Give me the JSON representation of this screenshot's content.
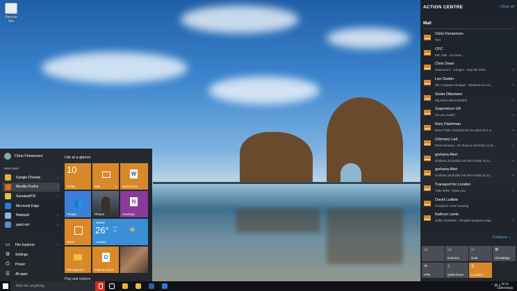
{
  "desktop": {
    "icon_label": "Recycle Bin"
  },
  "start_menu": {
    "user": "Chris Finnamore",
    "most_used_label": "Most used",
    "apps": [
      {
        "label": "Google Chrome",
        "color": "#e8b23a",
        "arrow": true
      },
      {
        "label": "Mozilla Firefox",
        "color": "#e0662a",
        "arrow": true
      },
      {
        "label": "SumatraPDF",
        "color": "#e8c23a",
        "arrow": true
      },
      {
        "label": "Microsoft Edge",
        "color": "#2a7bd9",
        "arrow": false
      },
      {
        "label": "Notepad",
        "color": "#8fb8d8",
        "arrow": true
      },
      {
        "label": "paint.net",
        "color": "#5a8ad0",
        "arrow": true
      }
    ],
    "system": [
      {
        "label": "File Explorer",
        "icon": "folder-icon",
        "glyph": "▭",
        "arrow": true
      },
      {
        "label": "Settings",
        "icon": "gear-icon",
        "glyph": "⚙",
        "arrow": false
      },
      {
        "label": "Power",
        "icon": "power-icon",
        "glyph": "⏻",
        "arrow": false
      },
      {
        "label": "All apps",
        "icon": "list-icon",
        "glyph": "☰",
        "arrow": false
      }
    ],
    "life_heading": "Life at a glance",
    "play_heading": "Play and explore",
    "tiles": {
      "calendar_day": "10",
      "calendar_label": "Friday",
      "mail_label": "Mail",
      "mail_count": "1",
      "word_label": "Word 2013",
      "people_label": "People",
      "photos_label": "Photos",
      "onenote_label": "OneNote",
      "store_label": "Store",
      "weather_condition": "Sunny",
      "weather_temp": "26°",
      "weather_hilo": "27°\n17°",
      "weather_city": "London",
      "fileexplorer_label": "File Explorer",
      "outlook_label": "Outlook 2013",
      "news_label": ""
    }
  },
  "taskbar": {
    "search_placeholder": "Ask me anything",
    "time": "11:11",
    "date": "10/07/2015",
    "apps": [
      {
        "name": "task-view-icon",
        "color": "#ffffff"
      },
      {
        "name": "chrome-icon",
        "color": "#e8b23a"
      },
      {
        "name": "file-explorer-icon",
        "color": "#e8c23a"
      },
      {
        "name": "word-icon",
        "color": "#2a5fb0"
      },
      {
        "name": "outlook-icon",
        "color": "#2a7bd9"
      }
    ]
  },
  "action_centre": {
    "title": "ACTION CENTRE",
    "clear_all": "Clear all",
    "mail_header": "Mail",
    "notifications": [
      {
        "from": "Chris Finnamore",
        "msg": "Test",
        "chevron": false
      },
      {
        "from": "CPC",
        "msg": "BIG Sale - Out Now...",
        "chevron": false
      },
      {
        "from": "Chris Dean",
        "msg": "Gamescom - Cologne - Sept 5th 2015",
        "chevron": true
      },
      {
        "from": "Lee Geden",
        "msg": "RE: Computer Shopper - Windows 10 em...",
        "chevron": true
      },
      {
        "from": "Giulia Ottaviano",
        "msg": "Big News about NUMIX!",
        "chevron": true
      },
      {
        "from": "Supermicro UK",
        "msg": "Are you ready?",
        "chevron": true
      },
      {
        "from": "Rory Flashman",
        "msg": "News Flash: Exceptional Innovation B.V. a...",
        "chevron": true
      },
      {
        "from": "Chimney Lad",
        "msg": "Press Release - EH Turns to MARVEL CUS...",
        "chevron": true
      },
      {
        "from": "gorkana Alert",
        "msg": "Gorkana Journalist Job Alert Friday 10 Ju...",
        "chevron": true
      },
      {
        "from": "gorkana Alert",
        "msg": "Gorkana Journalist Job Alert Friday 10 Ju...",
        "chevron": true
      },
      {
        "from": "Transport for London",
        "msg": "Tube strike - thank you",
        "chevron": true
      },
      {
        "from": "David Ludlow",
        "msg": "Accepted: Cover meeting",
        "chevron": false
      },
      {
        "from": "Kathryn Lamb",
        "msg": "Scifier R100000 - Versatile speakers requi...",
        "chevron": true
      }
    ],
    "collapse": "Collapse",
    "quick_actions": [
      {
        "label": "",
        "glyph": "▭",
        "icon": "tablet-mode-icon",
        "active": false
      },
      {
        "label": "Connect",
        "glyph": "▭",
        "icon": "connect-icon",
        "active": false
      },
      {
        "label": "Note",
        "glyph": "▱",
        "icon": "note-icon",
        "active": false
      },
      {
        "label": "All settings",
        "glyph": "⚙",
        "icon": "settings-icon",
        "active": false
      },
      {
        "label": "VPN",
        "glyph": "⟲",
        "icon": "vpn-icon",
        "active": false
      },
      {
        "label": "Quiet hours",
        "glyph": "☾",
        "icon": "moon-icon",
        "active": false
      },
      {
        "label": "Location",
        "glyph": "⚲",
        "icon": "location-icon",
        "active": true
      }
    ],
    "accent": "#d9882a"
  }
}
